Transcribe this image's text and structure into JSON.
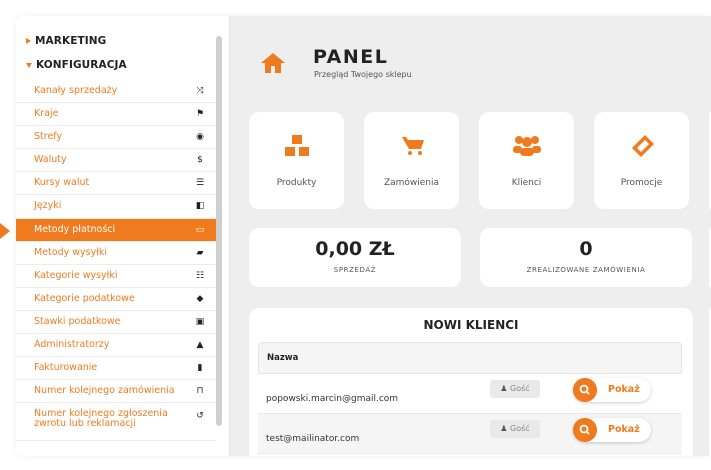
{
  "colors": {
    "accent": "#f07b1e"
  },
  "sidebar": {
    "marketing": "MARKETING",
    "konfiguracja": "KONFIGURACJA",
    "items": [
      {
        "label": "Kanały sprzedaży",
        "icon": "shuffle-icon",
        "glyph": "⤨"
      },
      {
        "label": "Kraje",
        "icon": "flag-icon",
        "glyph": "⚑"
      },
      {
        "label": "Strefy",
        "icon": "globe-icon",
        "glyph": "◉"
      },
      {
        "label": "Waluty",
        "icon": "dollar-icon",
        "glyph": "$"
      },
      {
        "label": "Kursy walut",
        "icon": "sliders-icon",
        "glyph": "☰"
      },
      {
        "label": "Języki",
        "icon": "language-icon",
        "glyph": "◧"
      },
      {
        "label": "Metody płatności",
        "icon": "credit-card-icon",
        "glyph": "▭",
        "active": true
      },
      {
        "label": "Metody wysyłki",
        "icon": "truck-icon",
        "glyph": "▰"
      },
      {
        "label": "Kategorie wysyłki",
        "icon": "list-icon",
        "glyph": "☷"
      },
      {
        "label": "Kategorie podatkowe",
        "icon": "tag-icon",
        "glyph": "◆"
      },
      {
        "label": "Stawki podatkowe",
        "icon": "money-icon",
        "glyph": "▣"
      },
      {
        "label": "Administratorzy",
        "icon": "lock-icon",
        "glyph": "▲"
      },
      {
        "label": "Fakturowanie",
        "icon": "file-icon",
        "glyph": "▮"
      },
      {
        "label": "Numer kolejnego zamówienia",
        "icon": "cart-icon",
        "glyph": "⊓"
      },
      {
        "label": "Numer kolejnego zgłoszenia zwrotu lub reklamacji",
        "icon": "undo-icon",
        "glyph": "↺"
      }
    ]
  },
  "header": {
    "title": "PANEL",
    "subtitle": "Przegląd Twojego sklepu",
    "icon": "home-icon"
  },
  "tiles": [
    {
      "label": "Produkty",
      "icon": "cubes-icon"
    },
    {
      "label": "Zamówienia",
      "icon": "cart-icon"
    },
    {
      "label": "Klienci",
      "icon": "users-icon"
    },
    {
      "label": "Promocje",
      "icon": "ticket-icon"
    }
  ],
  "stats": [
    {
      "value": "0,00 ZŁ",
      "caption": "SPRZEDAŻ"
    },
    {
      "value": "0",
      "caption": "ZREALIZOWANE ZAMÓWIENIA"
    }
  ],
  "customers": {
    "title": "NOWI KLIENCI",
    "column": "Nazwa",
    "rows": [
      {
        "email": "popowski.marcin@gmail.com",
        "type": "Gość",
        "action": "Pokaż"
      },
      {
        "email": "test@mailinator.com",
        "type": "Gość",
        "action": "Pokaż"
      }
    ]
  }
}
